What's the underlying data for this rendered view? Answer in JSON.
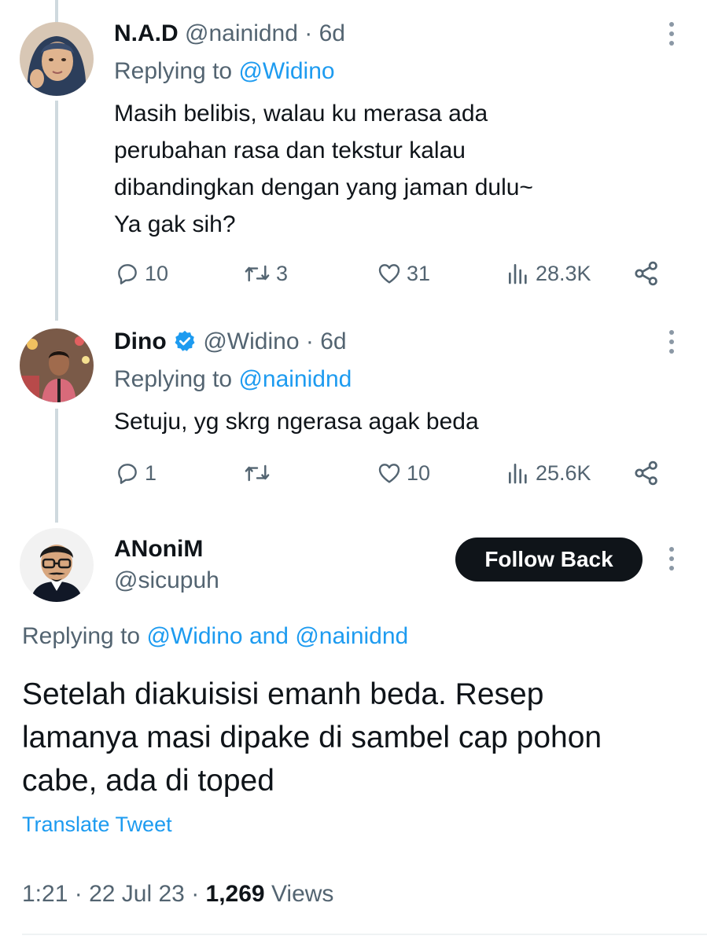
{
  "tweets": [
    {
      "name": "N.A.D",
      "handle": "@nainidnd",
      "time": "6d",
      "reply_prefix": "Replying to",
      "reply_to": "@Widino",
      "text_lines": [
        "Masih belibis, walau ku merasa ada",
        "perubahan rasa dan tekstur kalau",
        "dibandingkan dengan yang jaman dulu~",
        "Ya gak sih?"
      ],
      "stats": {
        "replies": "10",
        "retweets": "3",
        "likes": "31",
        "views": "28.3K"
      }
    },
    {
      "name": "Dino",
      "verified": true,
      "handle": "@Widino",
      "time": "6d",
      "reply_prefix": "Replying to",
      "reply_to": "@nainidnd",
      "text_lines": [
        "Setuju, yg skrg ngerasa agak beda"
      ],
      "stats": {
        "replies": "1",
        "retweets": "",
        "likes": "10",
        "views": "25.6K"
      }
    }
  ],
  "main_tweet": {
    "name": "ANoniM",
    "handle": "@sicupuh",
    "follow_label": "Follow Back",
    "reply_prefix": "Replying to",
    "reply_to_1": "@Widino",
    "reply_and": "and",
    "reply_to_2": "@nainidnd",
    "text_lines": [
      "Setelah diakuisisi emanh beda. Resep",
      "lamanya masi dipake di sambel cap pohon",
      "cabe, ada di toped"
    ],
    "translate_label": "Translate Tweet",
    "time": "1:21",
    "date": "22 Jul 23",
    "views_count": "1,269",
    "views_label": "Views"
  },
  "separator": "·",
  "icons": [
    "reply-icon",
    "retweet-icon",
    "like-icon",
    "views-icon",
    "share-icon",
    "more-icon",
    "verified-badge-icon"
  ],
  "colors": {
    "link": "#1d9bf0",
    "muted": "#536471",
    "text": "#0f1419",
    "thread_line": "#cfd9de"
  }
}
